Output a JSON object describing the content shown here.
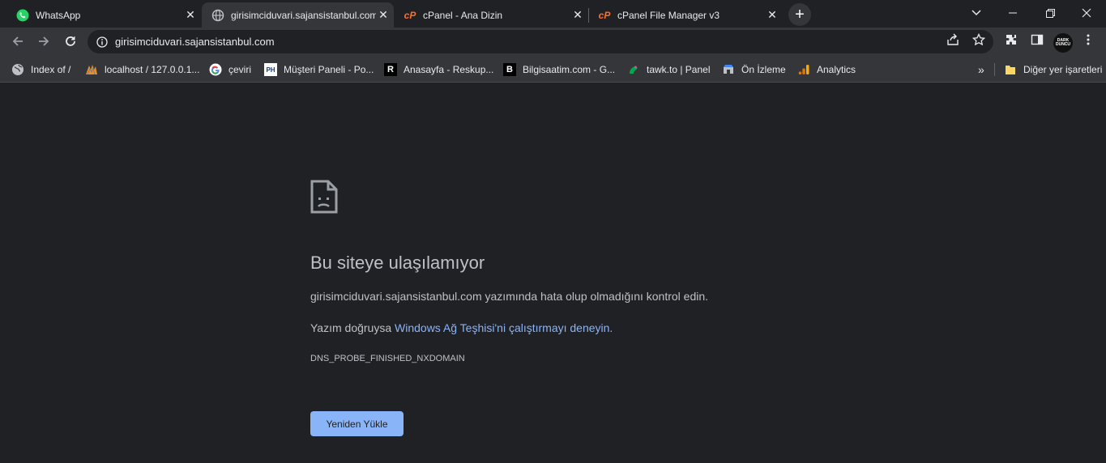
{
  "tabs": [
    {
      "title": "WhatsApp",
      "icon": "whatsapp-icon"
    },
    {
      "title": "girisimciduvari.sajansistanbul.com",
      "icon": "globe-icon"
    },
    {
      "title": "cPanel - Ana Dizin",
      "icon": "cpanel-icon"
    },
    {
      "title": "cPanel File Manager v3",
      "icon": "cpanel-icon"
    }
  ],
  "address_bar": {
    "url": "girisimciduvari.sajansistanbul.com"
  },
  "profile": {
    "label": "DARK DUNCU"
  },
  "bookmarks": [
    {
      "label": "Index of /",
      "icon": "globe-icon"
    },
    {
      "label": "localhost / 127.0.0.1...",
      "icon": "phpmyadmin-icon"
    },
    {
      "label": "çeviri",
      "icon": "google-icon"
    },
    {
      "label": "Müşteri Paneli - Po...",
      "icon": "ph-icon"
    },
    {
      "label": "Anasayfa - Reskup...",
      "icon": "r-icon"
    },
    {
      "label": "Bilgisaatim.com - G...",
      "icon": "b-icon"
    },
    {
      "label": "tawk.to | Panel",
      "icon": "tawk-icon"
    },
    {
      "label": "Ön İzleme",
      "icon": "preview-icon"
    },
    {
      "label": "Analytics",
      "icon": "analytics-icon"
    }
  ],
  "bookmarks_overflow": "»",
  "other_bookmarks": "Diğer yer işaretleri",
  "error": {
    "title": "Bu siteye ulaşılamıyor",
    "line1": "girisimciduvari.sajansistanbul.com yazımında hata olup olmadığını kontrol edin.",
    "line2_prefix": "Yazım doğruysa ",
    "line2_link": "Windows Ağ Teşhisi'ni çalıştırmayı deneyin.",
    "code": "DNS_PROBE_FINISHED_NXDOMAIN",
    "reload_label": "Yeniden Yükle"
  },
  "colors": {
    "background": "#202124",
    "toolbar": "#35363a",
    "link": "#8ab4f8",
    "text": "#bdc1c6"
  }
}
